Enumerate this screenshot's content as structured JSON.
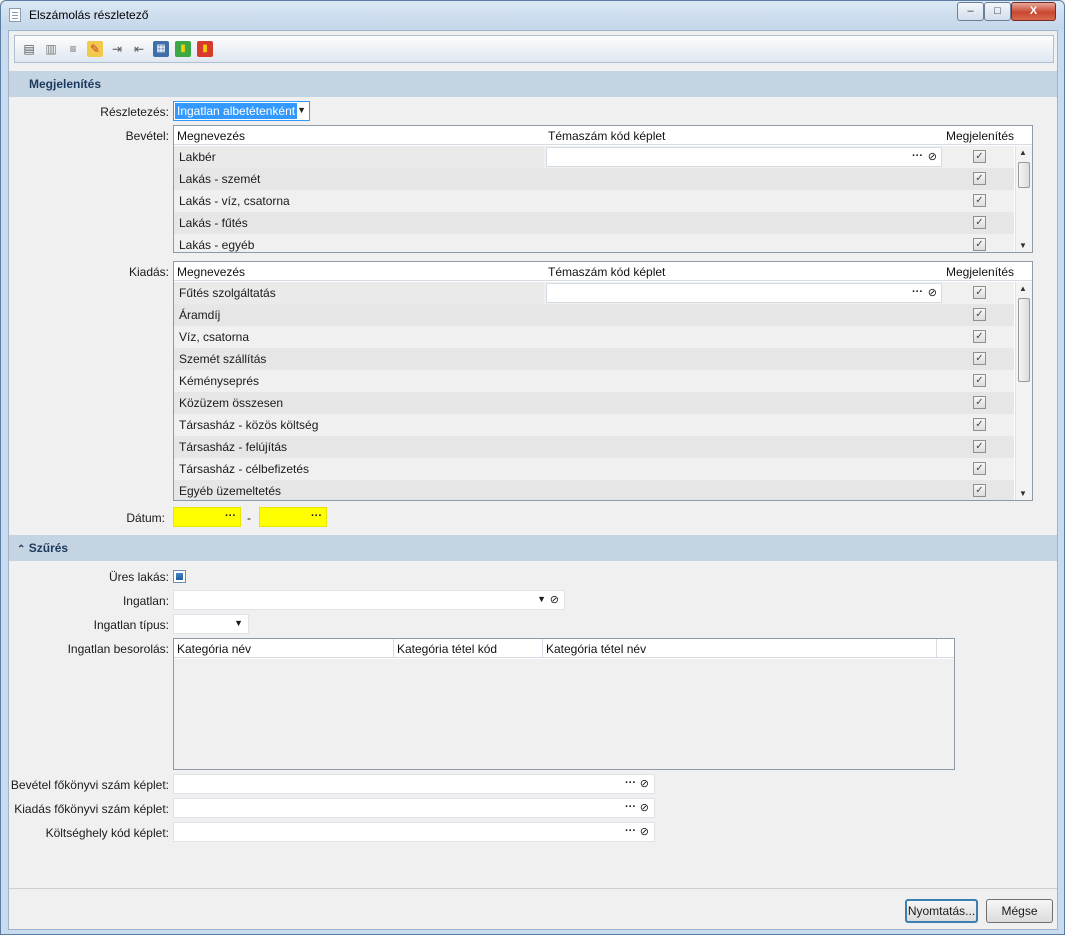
{
  "window": {
    "title": "Elszámolás részletező",
    "controls": {
      "minimize": "–",
      "maximize": "□",
      "close": "X"
    }
  },
  "toolbar": {
    "icons": [
      "print-icon",
      "print-preview-icon",
      "align-left-icon",
      "edit-icon",
      "export-icon",
      "import-icon",
      "calculator-icon",
      "book-icon",
      "books-icon"
    ]
  },
  "display": {
    "section_title": "Megjelenítés",
    "detail_label": "Részletezés:",
    "detail_value": "Ingatlan albetétenként",
    "income_label": "Bevétel:",
    "expense_label": "Kiadás:",
    "columns": {
      "name": "Megnevezés",
      "formula": "Témaszám kód képlet",
      "show": "Megjelenítés"
    },
    "income_rows": [
      {
        "name": "Lakbér",
        "checked": "✓"
      },
      {
        "name": "Lakás - szemét",
        "checked": "✓"
      },
      {
        "name": "Lakás - víz, csatorna",
        "checked": "✓"
      },
      {
        "name": "Lakás - fűtés",
        "checked": "✓"
      },
      {
        "name": "Lakás - egyéb",
        "checked": "✓"
      }
    ],
    "expense_rows": [
      {
        "name": "Fűtés szolgáltatás",
        "checked": "✓"
      },
      {
        "name": "Áramdíj",
        "checked": "✓"
      },
      {
        "name": "Víz, csatorna",
        "checked": "✓"
      },
      {
        "name": "Szemét szállítás",
        "checked": "✓"
      },
      {
        "name": "Kéményseprés",
        "checked": "✓"
      },
      {
        "name": "Közüzem összesen",
        "checked": "✓"
      },
      {
        "name": "Társasház - közös költség",
        "checked": "✓"
      },
      {
        "name": "Társasház - felújítás",
        "checked": "✓"
      },
      {
        "name": "Társasház - célbefizetés",
        "checked": "✓"
      },
      {
        "name": "Egyéb üzemeltetés",
        "checked": "✓"
      }
    ],
    "date_label": "Dátum:",
    "date_separator": "-",
    "ellipsis": "···",
    "clip": "📎"
  },
  "filter": {
    "section_title": "Szűrés",
    "empty_flat_label": "Üres lakás:",
    "property_label": "Ingatlan:",
    "property_type_label": "Ingatlan típus:",
    "classification_label": "Ingatlan besorolás:",
    "class_columns": {
      "cat_name": "Kategória név",
      "item_code": "Kategória tétel kód",
      "item_name": "Kategória tétel név"
    },
    "income_ledger_label": "Bevétel főkönyvi szám képlet:",
    "expense_ledger_label": "Kiadás főkönyvi szám képlet:",
    "cost_center_label": "Költséghely kód képlet:"
  },
  "buttons": {
    "print": "Nyomtatás...",
    "cancel": "Mégse"
  },
  "colors": {
    "accent": "#3399ff",
    "required_field": "#ffff00",
    "section_bg": "#c5d4e2"
  }
}
